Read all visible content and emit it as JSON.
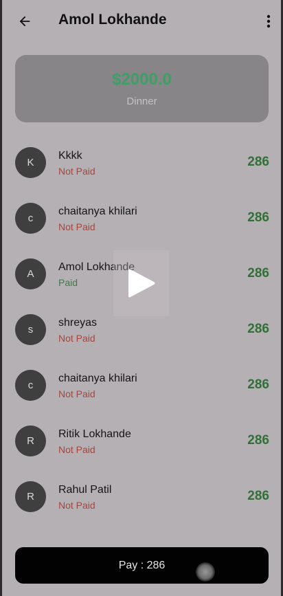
{
  "appbar": {
    "title": "Amol Lokhande",
    "back_icon": "arrow-back-icon",
    "menu_icon": "more-vert-icon"
  },
  "summary": {
    "amount": "$2000.0",
    "description": "Dinner",
    "amount_color": "#3f9e66"
  },
  "members": [
    {
      "initial": "K",
      "name": "Kkkk",
      "status": "Not Paid",
      "paid": false,
      "share": "286"
    },
    {
      "initial": "c",
      "name": "chaitanya khilari",
      "status": "Not Paid",
      "paid": false,
      "share": "286"
    },
    {
      "initial": "A",
      "name": "Amol Lokhande",
      "status": "Paid",
      "paid": true,
      "share": "286"
    },
    {
      "initial": "s",
      "name": "shreyas",
      "status": "Not Paid",
      "paid": false,
      "share": "286"
    },
    {
      "initial": "c",
      "name": "chaitanya khilari",
      "status": "Not Paid",
      "paid": false,
      "share": "286"
    },
    {
      "initial": "R",
      "name": "Ritik Lokhande",
      "status": "Not Paid",
      "paid": false,
      "share": "286"
    },
    {
      "initial": "R",
      "name": "Rahul Patil",
      "status": "Not Paid",
      "paid": false,
      "share": "286"
    }
  ],
  "pay_button": {
    "label": "Pay  : 286"
  },
  "overlay": {
    "icon": "play-icon"
  },
  "colors": {
    "unpaid": "#a5463e",
    "paid": "#3b7d45",
    "share": "#326f38"
  }
}
